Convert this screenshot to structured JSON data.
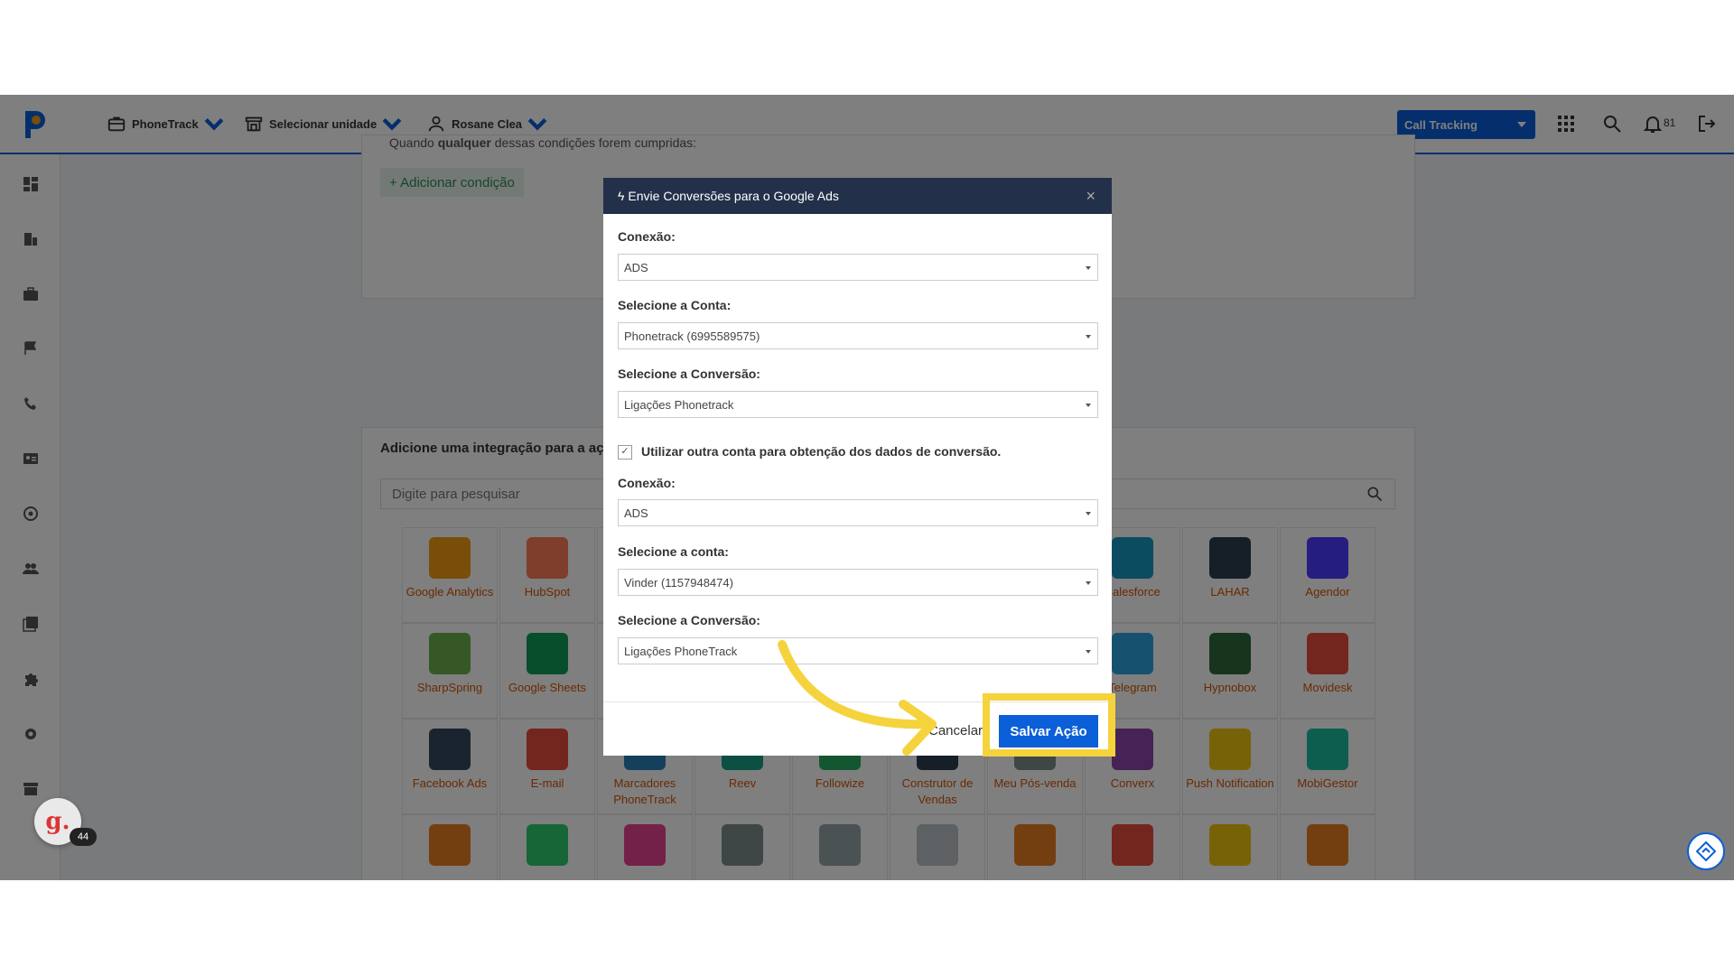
{
  "topbar": {
    "menus": [
      {
        "label": "PhoneTrack",
        "icon": "briefcase-icon"
      },
      {
        "label": "Selecionar unidade",
        "icon": "store-icon"
      },
      {
        "label": "Rosane Clea",
        "icon": "user-icon"
      }
    ],
    "call_tracking_label": "Call Tracking",
    "notification_count": "81"
  },
  "background": {
    "condition_text_prefix": "Quando ",
    "condition_text_bold": "qualquer",
    "condition_text_suffix": " dessas condições forem cumpridas:",
    "add_condition_label": "+ Adicionar condição",
    "integration_title": "Adicione uma integração para a ação",
    "search_placeholder": "Digite para pesquisar",
    "tiles": [
      {
        "label": "Google Analytics",
        "color": "#f39c12"
      },
      {
        "label": "HubSpot",
        "color": "#ff7a59"
      },
      {
        "label": "",
        "color": "#cccccc"
      },
      {
        "label": "",
        "color": "#cccccc"
      },
      {
        "label": "",
        "color": "#cccccc"
      },
      {
        "label": "",
        "color": "#cccccc"
      },
      {
        "label": "",
        "color": "#cccccc"
      },
      {
        "label": "Salesforce",
        "color": "#1798c1"
      },
      {
        "label": "LAHAR",
        "color": "#2c3e50"
      },
      {
        "label": "Agendor",
        "color": "#4a3aff"
      },
      {
        "label": "SharpSpring",
        "color": "#6ab04c"
      },
      {
        "label": "Google Sheets",
        "color": "#0f9d58"
      },
      {
        "label": "",
        "color": "#cccccc"
      },
      {
        "label": "",
        "color": "#cccccc"
      },
      {
        "label": "",
        "color": "#cccccc"
      },
      {
        "label": "",
        "color": "#cccccc"
      },
      {
        "label": "",
        "color": "#cccccc"
      },
      {
        "label": "Telegram",
        "color": "#2ca5e0"
      },
      {
        "label": "Hypnobox",
        "color": "#2f6b3a"
      },
      {
        "label": "Movidesk",
        "color": "#e74c3c"
      },
      {
        "label": "Facebook Ads",
        "color": "#34495e"
      },
      {
        "label": "E-mail",
        "color": "#e74c3c"
      },
      {
        "label": "Marcadores PhoneTrack",
        "color": "#2980b9"
      },
      {
        "label": "Reev",
        "color": "#16a085"
      },
      {
        "label": "Followize",
        "color": "#27ae60"
      },
      {
        "label": "Construtor de Vendas",
        "color": "#2c3e50"
      },
      {
        "label": "Meu Pós-venda",
        "color": "#7f8c8d"
      },
      {
        "label": "Converx",
        "color": "#8e44ad"
      },
      {
        "label": "Push Notification",
        "color": "#f1c40f"
      },
      {
        "label": "MobiGestor",
        "color": "#1abc9c"
      },
      {
        "label": "",
        "color": "#e67e22"
      },
      {
        "label": "",
        "color": "#2ecc71"
      },
      {
        "label": "",
        "color": "#e84393"
      },
      {
        "label": "",
        "color": "#7f8c8d"
      },
      {
        "label": "",
        "color": "#95a5a6"
      },
      {
        "label": "",
        "color": "#bdc3c7"
      },
      {
        "label": "",
        "color": "#e67e22"
      },
      {
        "label": "",
        "color": "#e74c3c"
      },
      {
        "label": "",
        "color": "#f1c40f"
      },
      {
        "label": "",
        "color": "#e67e22"
      }
    ]
  },
  "modal": {
    "title": "Envie Conversões para o Google Ads",
    "close": "×",
    "fields": [
      {
        "label": "Conexão:",
        "value": "ADS"
      },
      {
        "label": "Selecione a Conta:",
        "value": "Phonetrack (6995589575)"
      },
      {
        "label": "Selecione a Conversão:",
        "value": "Ligações Phonetrack"
      }
    ],
    "checkbox_label": "Utilizar outra conta para obtenção dos dados de conversão.",
    "checkbox_checked": true,
    "fields2": [
      {
        "label": "Conexão:",
        "value": "ADS"
      },
      {
        "label": "Selecione a conta:",
        "value": "Vinder (1157948474)"
      },
      {
        "label": "Selecione a Conversão:",
        "value": "Ligações PhoneTrack"
      }
    ],
    "cancel_label": "Cancelar",
    "save_label": "Salvar Ação"
  },
  "chat_widget": {
    "letter": "g.",
    "count": "44"
  },
  "colors": {
    "accent": "#0b5fd8",
    "highlight": "#f5d33d",
    "modal_header": "#23304a"
  }
}
